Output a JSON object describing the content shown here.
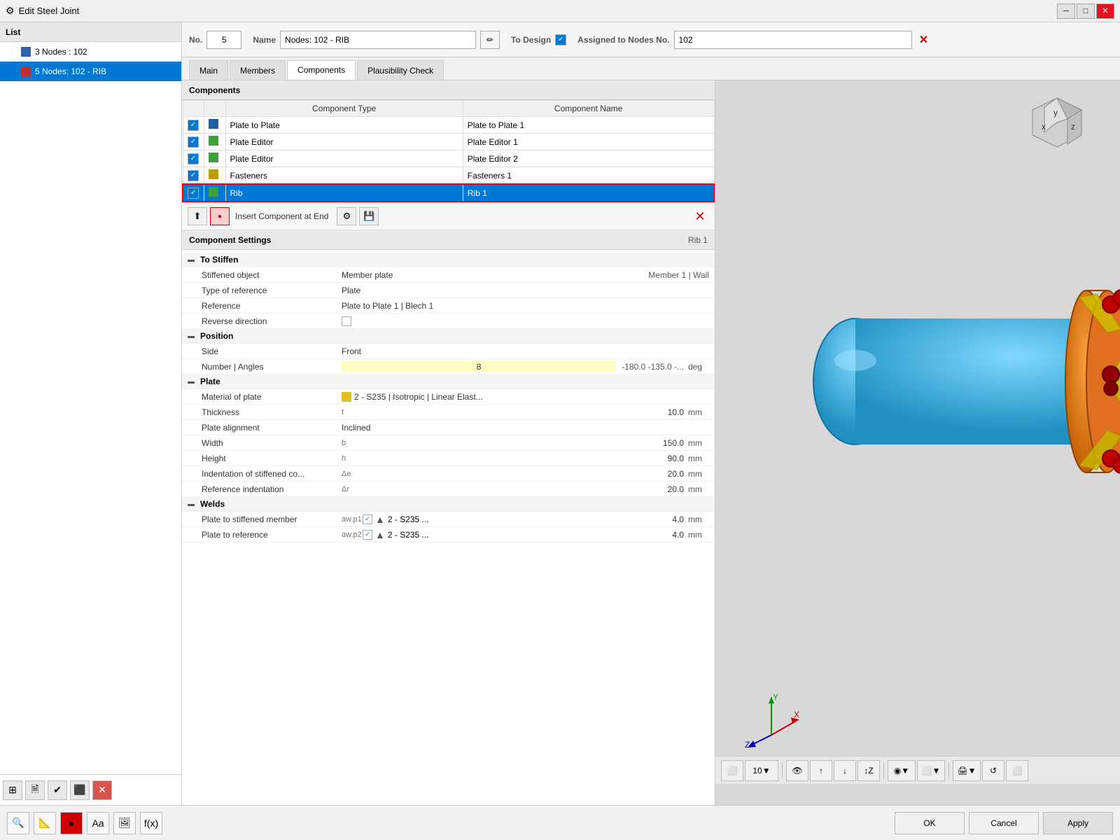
{
  "window": {
    "title": "Edit Steel Joint",
    "icon": "⚙"
  },
  "top_fields": {
    "no_label": "No.",
    "no_value": "5",
    "name_label": "Name",
    "name_value": "Nodes: 102 - RIB",
    "to_design_label": "To Design",
    "assigned_label": "Assigned to Nodes No.",
    "assigned_value": "102"
  },
  "tabs": [
    {
      "id": "main",
      "label": "Main"
    },
    {
      "id": "members",
      "label": "Members"
    },
    {
      "id": "components",
      "label": "Components"
    },
    {
      "id": "plausibility",
      "label": "Plausibility Check"
    }
  ],
  "active_tab": "components",
  "components_section": {
    "title": "Components",
    "columns": [
      "Component Type",
      "Component Name"
    ],
    "rows": [
      {
        "checked": true,
        "icon": "blue",
        "type": "Plate to Plate",
        "name": "Plate to Plate 1",
        "selected": false
      },
      {
        "checked": true,
        "icon": "green",
        "type": "Plate Editor",
        "name": "Plate Editor 1",
        "selected": false
      },
      {
        "checked": true,
        "icon": "green",
        "type": "Plate Editor",
        "name": "Plate Editor 2",
        "selected": false
      },
      {
        "checked": true,
        "icon": "yellow",
        "type": "Fasteners",
        "name": "Fasteners 1",
        "selected": false
      },
      {
        "checked": true,
        "icon": "green",
        "type": "Rib",
        "name": "Rib 1",
        "selected": true,
        "red_border": true
      }
    ]
  },
  "toolbar": {
    "insert_label": "Insert Component at End",
    "buttons": [
      "⬅",
      "➕",
      "➕",
      "💾",
      "✕"
    ]
  },
  "settings": {
    "title": "Component Settings",
    "component_name": "Rib 1",
    "groups": [
      {
        "name": "To Stiffen",
        "collapsed": false,
        "rows": [
          {
            "label": "Stiffened object",
            "key": "",
            "value": "Member plate",
            "extra": "Member 1 | Wall"
          },
          {
            "label": "Type of reference",
            "key": "",
            "value": "Plate",
            "extra": ""
          },
          {
            "label": "Reference",
            "key": "",
            "value": "Plate to Plate 1 | Blech 1",
            "extra": ""
          },
          {
            "label": "Reverse direction",
            "key": "",
            "value": "checkbox_unchecked",
            "extra": ""
          }
        ]
      },
      {
        "name": "Position",
        "collapsed": false,
        "rows": [
          {
            "label": "Side",
            "key": "",
            "value": "Front",
            "extra": ""
          },
          {
            "label": "Number | Angles",
            "key": "",
            "value": "8",
            "extra": "-180.0 -135.0 -...",
            "unit": "deg"
          }
        ]
      },
      {
        "name": "Plate",
        "collapsed": false,
        "rows": [
          {
            "label": "Material of plate",
            "key": "",
            "value": "2 - S235 | Isotropic | Linear Elast...",
            "extra": "",
            "material": true
          },
          {
            "label": "Thickness",
            "key": "t",
            "value": "10.0",
            "unit": "mm"
          },
          {
            "label": "Plate alignment",
            "key": "",
            "value": "Inclined",
            "extra": ""
          },
          {
            "label": "Width",
            "key": "b",
            "value": "150.0",
            "unit": "mm"
          },
          {
            "label": "Height",
            "key": "h",
            "value": "90.0",
            "unit": "mm"
          },
          {
            "label": "Indentation of stiffened co...",
            "key": "Δe",
            "value": "20.0",
            "unit": "mm"
          },
          {
            "label": "Reference indentation",
            "key": "Δr",
            "value": "20.0",
            "unit": "mm"
          }
        ]
      },
      {
        "name": "Welds",
        "collapsed": false,
        "rows": [
          {
            "label": "Plate to stiffened member",
            "key": "aw,p1",
            "weld": true,
            "weld_value": "2 - S235 ...",
            "value": "4.0",
            "unit": "mm"
          },
          {
            "label": "Plate to reference",
            "key": "aw,p2",
            "weld": true,
            "weld_value": "2 - S235 ...",
            "value": "4.0",
            "unit": "mm"
          }
        ]
      }
    ]
  },
  "bottom_bar": {
    "icons": [
      "🔍",
      "📐",
      "🔴",
      "Aa",
      "🖼",
      "f(x)"
    ],
    "ok_label": "OK",
    "cancel_label": "Cancel",
    "apply_label": "Apply"
  },
  "list": {
    "title": "List",
    "items": [
      {
        "label": "3 Nodes : 102",
        "icon": "blue",
        "selected": false
      },
      {
        "label": "5 Nodes: 102 - RIB",
        "icon": "red",
        "selected": true
      }
    ]
  },
  "view_3d": {
    "toolbar_icons": [
      "⬜",
      "10▼",
      "👁",
      "⬆",
      "⬇",
      "↕Z",
      "↕",
      "◉▼",
      "🖨▼",
      "🔄",
      "⬜"
    ]
  },
  "axis": {
    "x": "X",
    "y": "Y",
    "z": "Z",
    "x_color": "#cc0000",
    "y_color": "#009900",
    "z_color": "#0000cc"
  }
}
